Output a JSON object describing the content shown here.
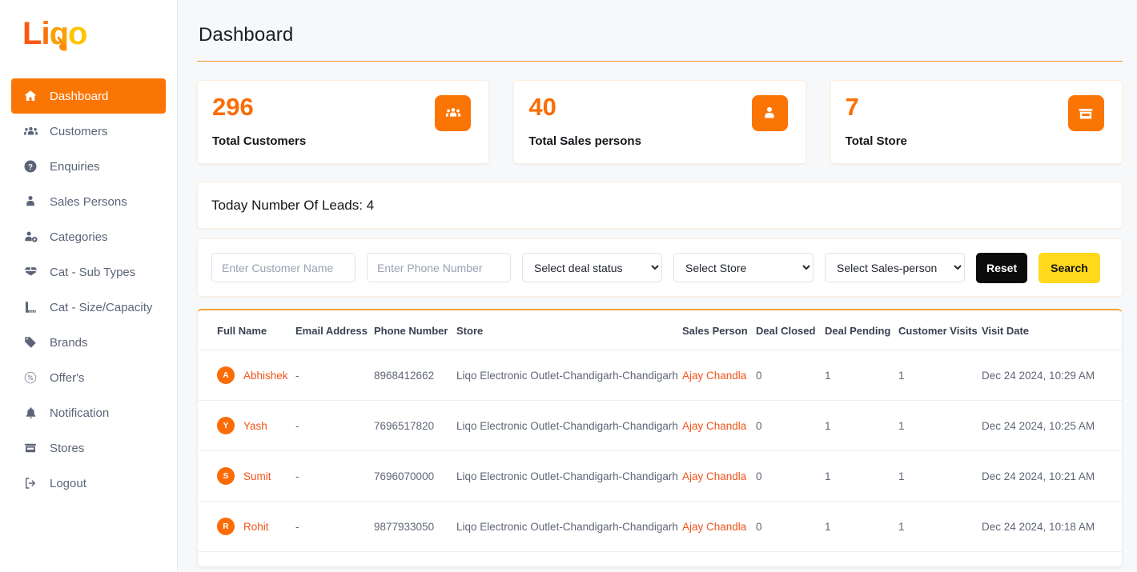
{
  "brand": {
    "logo_text": "Liqo",
    "logo_parts": [
      "L",
      "i",
      "q",
      "o"
    ]
  },
  "sidebar": {
    "items": [
      {
        "label": "Dashboard",
        "icon": "home-icon",
        "active": true
      },
      {
        "label": "Customers",
        "icon": "users-icon",
        "active": false
      },
      {
        "label": "Enquiries",
        "icon": "question-icon",
        "active": false
      },
      {
        "label": "Sales Persons",
        "icon": "person-tie-icon",
        "active": false
      },
      {
        "label": "Categories",
        "icon": "person-gear-icon",
        "active": false
      },
      {
        "label": "Cat - Sub Types",
        "icon": "box-open-icon",
        "active": false
      },
      {
        "label": "Cat - Size/Capacity",
        "icon": "ruler-icon",
        "active": false
      },
      {
        "label": "Brands",
        "icon": "tag-icon",
        "active": false
      },
      {
        "label": "Offer's",
        "icon": "offer-circle-icon",
        "active": false
      },
      {
        "label": "Notification",
        "icon": "bell-icon",
        "active": false
      },
      {
        "label": "Stores",
        "icon": "store-icon",
        "active": false
      },
      {
        "label": "Logout",
        "icon": "logout-icon",
        "active": false
      }
    ]
  },
  "header": {
    "title": "Dashboard"
  },
  "stats": [
    {
      "value": "296",
      "label": "Total Customers",
      "icon": "users-icon"
    },
    {
      "value": "40",
      "label": "Total Sales persons",
      "icon": "person-tie-icon"
    },
    {
      "value": "7",
      "label": "Total Store",
      "icon": "store-icon"
    }
  ],
  "leads": {
    "text": "Today Number Of Leads: 4"
  },
  "filters": {
    "customer_name": {
      "value": "",
      "placeholder": "Enter Customer Name"
    },
    "phone_number": {
      "value": "",
      "placeholder": "Enter Phone Number"
    },
    "deal_status": {
      "selected": "Select deal status",
      "options": [
        "Select deal status"
      ]
    },
    "store": {
      "selected": "Select Store",
      "options": [
        "Select Store"
      ]
    },
    "sales_person": {
      "selected": "Select Sales-person",
      "options": [
        "Select Sales-person"
      ]
    },
    "reset_label": "Reset",
    "search_label": "Search"
  },
  "table": {
    "columns": [
      "Full Name",
      "Email Address",
      "Phone Number",
      "Store",
      "Sales Person",
      "Deal Closed",
      "Deal Pending",
      "Customer Visits",
      "Visit Date"
    ],
    "rows": [
      {
        "initial": "A",
        "name": "Abhishek",
        "email": "-",
        "phone": "8968412662",
        "store": "Liqo Electronic Outlet-Chandigarh-Chandigarh",
        "sales_person": "Ajay Chandla",
        "deal_closed": "0",
        "deal_pending": "1",
        "customer_visits": "1",
        "visit_date": "Dec 24 2024, 10:29 AM"
      },
      {
        "initial": "Y",
        "name": "Yash",
        "email": "-",
        "phone": "7696517820",
        "store": "Liqo Electronic Outlet-Chandigarh-Chandigarh",
        "sales_person": "Ajay Chandla",
        "deal_closed": "0",
        "deal_pending": "1",
        "customer_visits": "1",
        "visit_date": "Dec 24 2024, 10:25 AM"
      },
      {
        "initial": "S",
        "name": "Sumit",
        "email": "-",
        "phone": "7696070000",
        "store": "Liqo Electronic Outlet-Chandigarh-Chandigarh",
        "sales_person": "Ajay Chandla",
        "deal_closed": "0",
        "deal_pending": "1",
        "customer_visits": "1",
        "visit_date": "Dec 24 2024, 10:21 AM"
      },
      {
        "initial": "R",
        "name": "Rohit",
        "email": "-",
        "phone": "9877933050",
        "store": "Liqo Electronic Outlet-Chandigarh-Chandigarh",
        "sales_person": "Ajay Chandla",
        "deal_closed": "0",
        "deal_pending": "1",
        "customer_visits": "1",
        "visit_date": "Dec 24 2024, 10:18 AM"
      }
    ]
  },
  "colors": {
    "accent_orange": "#fb7505",
    "number_orange": "#fb6d07",
    "link_orange": "#f2541b",
    "search_yellow": "#ffd91a",
    "reset_black": "#0b0b0b",
    "page_bg": "#f7f8fa",
    "rule_orange": "#f0932b"
  }
}
